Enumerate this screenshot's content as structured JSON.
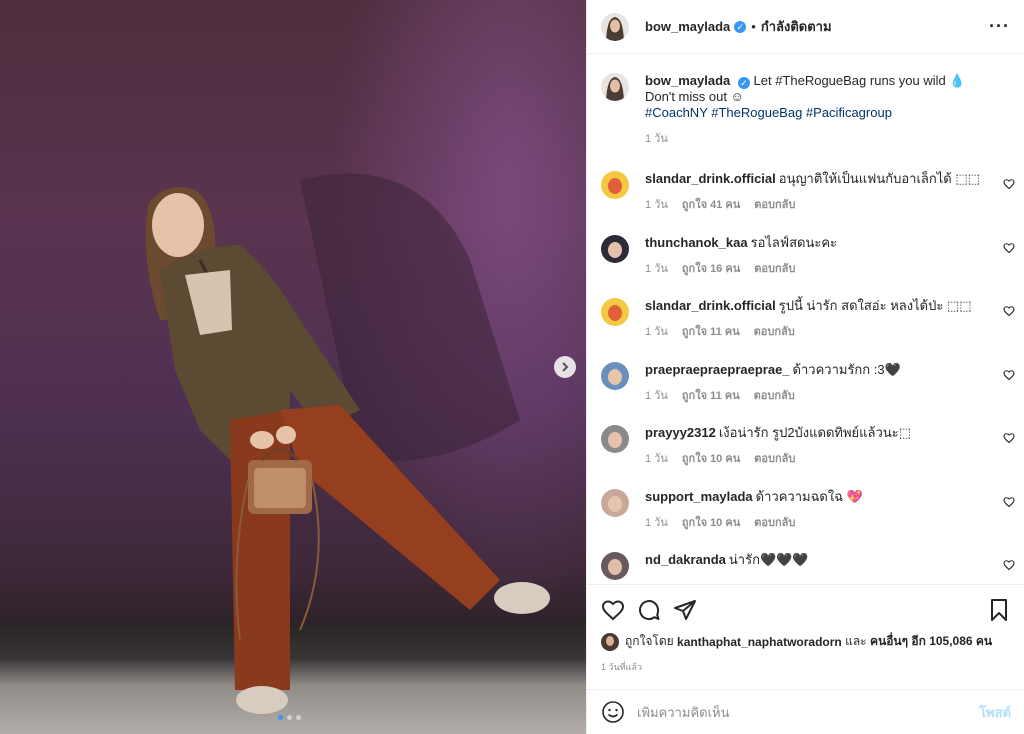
{
  "post": {
    "username": "bow_maylada",
    "verified_mark": "✓",
    "separator": "•",
    "follow_status": "กำลังติดตาม",
    "more_icon": "more-horizontal-icon",
    "caption_text": "Let #TheRogueBag runs you wild 💧 Don't miss out ☺",
    "caption_tags": "#CoachNY #TheRogueBag #Pacificagroup",
    "caption_time": "1 วัน",
    "carousel": {
      "total_images": 3,
      "active_index": 0
    },
    "accent_color": "#3897f0"
  },
  "comments": [
    {
      "username": "slandar_drink.official",
      "text": "อนุญาติให้เป็นแฟนกับอาเล็กได้ ⬚⬚",
      "time": "1 วัน",
      "likes": "ถูกใจ 41 คน",
      "reply": "ตอบกลับ"
    },
    {
      "username": "thunchanok_kaa",
      "text": "รอไลฟ์สดนะคะ",
      "time": "1 วัน",
      "likes": "ถูกใจ 16 คน",
      "reply": "ตอบกลับ"
    },
    {
      "username": "slandar_drink.official",
      "text": "รูปนี้ น่ารัก สดใสอ่ะ หลงได้ป่ะ ⬚⬚",
      "time": "1 วัน",
      "likes": "ถูกใจ 11 คน",
      "reply": "ตอบกลับ"
    },
    {
      "username": "praepraepraepraeprae_",
      "text": "ด้าวความรักก :3🖤",
      "time": "1 วัน",
      "likes": "ถูกใจ 11 คน",
      "reply": "ตอบกลับ"
    },
    {
      "username": "prayyy2312",
      "text": "เง้อน่ารัก รูป2บังแดดทิพย์แล้วนะ⬚",
      "time": "1 วัน",
      "likes": "ถูกใจ 10 คน",
      "reply": "ตอบกลับ"
    },
    {
      "username": "support_maylada",
      "text": "ด้าวความฉดใฉ 💖",
      "time": "1 วัน",
      "likes": "ถูกใจ 10 คน",
      "reply": "ตอบกลับ"
    },
    {
      "username": "nd_dakranda",
      "text": "น่ารัก🖤🖤🖤",
      "time": "",
      "likes": "",
      "reply": ""
    }
  ],
  "actions": {
    "like_icon": "heart-icon",
    "comment_icon": "comment-icon",
    "share_icon": "send-icon",
    "save_icon": "bookmark-icon",
    "liked_by_prefix": "ถูกใจโดย",
    "liked_by_user": "kanthaphat_naphatworadorn",
    "liked_by_and": "และ",
    "liked_by_others": "คนอื่นๆ อีก 105,086 คน",
    "timestamp": "1 วันที่แล้ว"
  },
  "add_comment": {
    "placeholder": "เพิ่มความคิดเห็น",
    "post_label": "โพสต์",
    "post_color": "#b2dffc"
  }
}
